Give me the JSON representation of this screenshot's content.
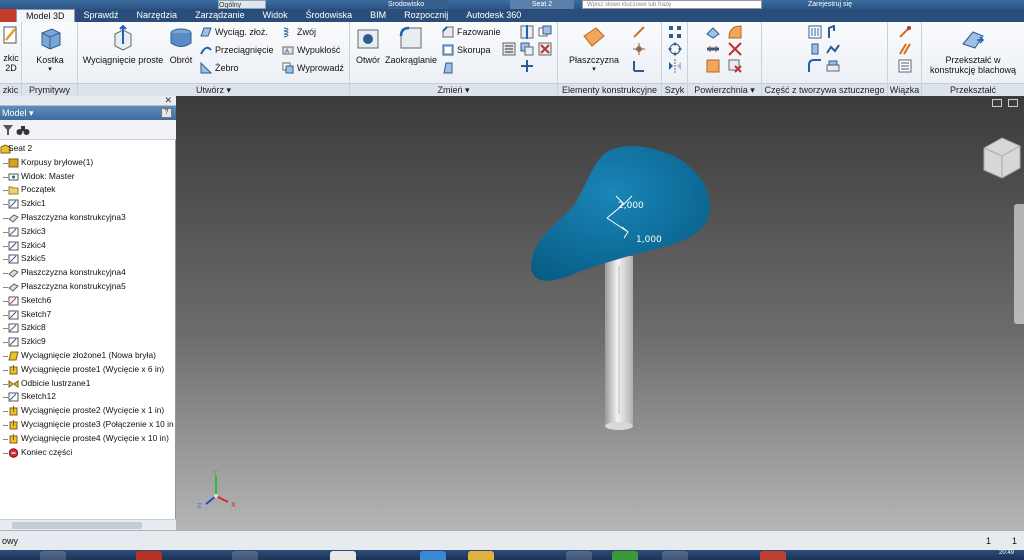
{
  "titlebar": {
    "style_box": "Ogólny",
    "project": "Środowisko",
    "document": "Seat 2",
    "search_placeholder": "Wpisz słowo kluczowe lub frazę",
    "login": "Zarejestruj się"
  },
  "tabs": [
    "Model 3D",
    "Sprawdź",
    "Narzędzia",
    "Zarządzanie",
    "Widok",
    "Środowiska",
    "BIM",
    "Rozpocznij",
    "Autodesk 360"
  ],
  "active_tab": "Model 3D",
  "ribbon": {
    "sketch_panel": {
      "button_line1": "zkic",
      "button_line2": "2D",
      "label": "zkic"
    },
    "primitives_panel": {
      "button": "Kostka",
      "label": "Prymitywy"
    },
    "create_panel": {
      "extrude": "Wyciągnięcie proste",
      "revolve": "Obrót",
      "loft": "Wyciąg. złoż.",
      "sweep": "Przeciągnięcie",
      "rib": "Żebro",
      "coil": "Zwój",
      "emboss": "Wypukłość",
      "derive": "Wyprowadź",
      "label": "Utwórz ▾"
    },
    "modify_panel": {
      "hole": "Otwór",
      "fillet": "Zaokrąglanie",
      "chamfer": "Fazowanie",
      "shell": "Skorupa",
      "label": "Zmień ▾"
    },
    "work_features_panel": {
      "plane": "Płaszczyzna",
      "label": "Elementy konstrukcyjne"
    },
    "pattern_panel": {
      "label": "Szyk"
    },
    "surface_panel": {
      "label": "Powierzchnia ▾"
    },
    "plastic_panel": {
      "label": "Część z tworzywa sztucznego"
    },
    "harness_panel": {
      "label": "Wiązka"
    },
    "convert_panel": {
      "button_line1": "Przekształć w",
      "button_line2": "konstrukcję blachową",
      "label": "Przekształć"
    }
  },
  "browser": {
    "title": "Model ▾",
    "help": "?",
    "tree": [
      {
        "label": "Seat 2",
        "icon": "part-icon",
        "root": true
      },
      {
        "label": "Korpusy bryłowe(1)",
        "icon": "solid-bodies-icon"
      },
      {
        "label": "Widok: Master",
        "icon": "view-icon"
      },
      {
        "label": "Początek",
        "icon": "origin-folder-icon"
      },
      {
        "label": "Szkic1",
        "icon": "sketch-icon"
      },
      {
        "label": "Płaszczyzna konstrukcyjna3",
        "icon": "work-plane-icon"
      },
      {
        "label": "Szkic3",
        "icon": "sketch-icon"
      },
      {
        "label": "Szkic4",
        "icon": "sketch-icon"
      },
      {
        "label": "Szkic5",
        "icon": "sketch-icon"
      },
      {
        "label": "Płaszczyzna konstrukcyjna4",
        "icon": "work-plane-icon"
      },
      {
        "label": "Płaszczyzna konstrukcyjna5",
        "icon": "work-plane-icon"
      },
      {
        "label": "Sketch6",
        "icon": "sketch-3d-icon"
      },
      {
        "label": "Sketch7",
        "icon": "sketch-icon"
      },
      {
        "label": "Szkic8",
        "icon": "sketch-icon"
      },
      {
        "label": "Szkic9",
        "icon": "sketch-icon"
      },
      {
        "label": "Wyciągnięcie złożone1 (Nowa bryła)",
        "icon": "loft-icon"
      },
      {
        "label": "Wyciągnięcie proste1 (Wycięcie x 6 in)",
        "icon": "extrude-icon"
      },
      {
        "label": "Odbicie lustrzane1",
        "icon": "mirror-icon"
      },
      {
        "label": "Sketch12",
        "icon": "sketch-icon"
      },
      {
        "label": "Wyciągnięcie proste2 (Wycięcie x 1 in)",
        "icon": "extrude-icon"
      },
      {
        "label": "Wyciągnięcie proste3 (Połączenie x 10 in",
        "icon": "extrude-icon"
      },
      {
        "label": "Wyciągnięcie proste4 (Wycięcie x 10 in)",
        "icon": "extrude-icon"
      },
      {
        "label": "Koniec części",
        "icon": "end-of-part-icon"
      }
    ]
  },
  "viewport": {
    "dimension_1": "2,000",
    "dimension_2": "1,000",
    "triad": {
      "x": "X",
      "y": "Y",
      "z": "Z"
    },
    "seat_color": "#0a6e9c"
  },
  "statusbar": {
    "text": "owy",
    "count_1": "1",
    "count_2": "1"
  },
  "taskbar": {
    "time": "20:49"
  }
}
